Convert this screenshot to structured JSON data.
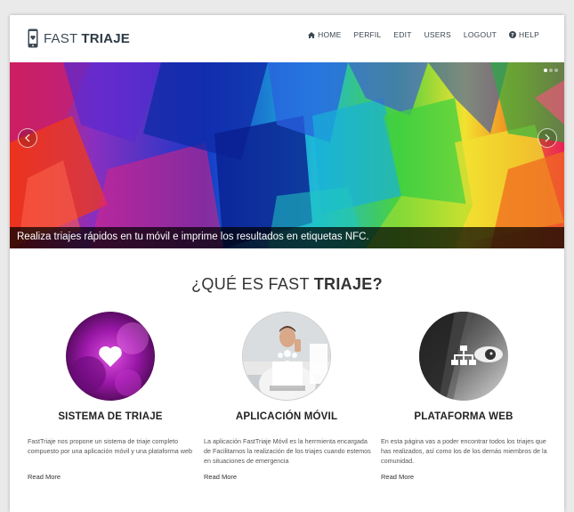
{
  "brand": {
    "light": "FAST ",
    "bold": "TRIAJE"
  },
  "nav": {
    "home": "HOME",
    "perfil": "PERFIL",
    "edit": "EDIT",
    "users": "USERS",
    "logout": "LOGOUT",
    "help": "HELP"
  },
  "slider": {
    "caption": "Realiza triajes rápidos en tu móvil e imprime los resultados en etiquetas NFC.",
    "dots": 3,
    "active_dot": 1
  },
  "section": {
    "title_light": "¿QUÉ ES FAST ",
    "title_bold": "TRIAJE",
    "title_end": "?"
  },
  "features": [
    {
      "icon": "heart-icon",
      "title": "SISTEMA DE TRIAJE",
      "text": "FastTriaje nos propone un sistema de triaje completo compuesto por una aplicación móvil y una plataforma web",
      "link": "Read More"
    },
    {
      "icon": "people-icon",
      "title": "APLICACIÓN MÓVIL",
      "text": "La aplicación FastTriaje Móvil es la herrmienta encargada de Facilitarnos la realización de los triajes cuando estemos en situaciones de emergencia",
      "link": "Read More"
    },
    {
      "icon": "sitemap-icon",
      "title": "PLATAFORMA WEB",
      "text": "En esta página vas a poder encontrar todos los triajes que has realizados, así como los de los demás miembros de la comunidad.",
      "link": "Read More"
    }
  ],
  "colors": {
    "header_text": "#3b4650",
    "caption_bg": "#000000",
    "title": "#222222"
  }
}
